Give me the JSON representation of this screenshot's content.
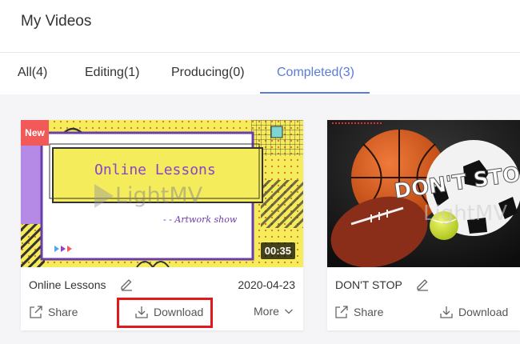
{
  "header": {
    "title": "My Videos"
  },
  "tabs": [
    {
      "label": "All(4)",
      "active": false
    },
    {
      "label": "Editing(1)",
      "active": false
    },
    {
      "label": "Producing(0)",
      "active": false
    },
    {
      "label": "Completed(3)",
      "active": true
    }
  ],
  "colors": {
    "accent": "#5b7bd8",
    "new_badge": "#f25a5a",
    "highlight": "#e01a1a"
  },
  "videos": [
    {
      "title": "Online Lessons",
      "date": "2020-04-23",
      "duration": "00:35",
      "badge": "New",
      "thumb_title": "Online Lessons",
      "thumb_subtitle": "- - Artwork show",
      "watermark": "LightMV",
      "actions": {
        "share": "Share",
        "download": "Download",
        "more": "More"
      }
    },
    {
      "title": "DON'T STOP",
      "thumb_title": "DON'T STOP",
      "watermark": "LightMV",
      "actions": {
        "share": "Share",
        "download": "Download"
      }
    }
  ]
}
